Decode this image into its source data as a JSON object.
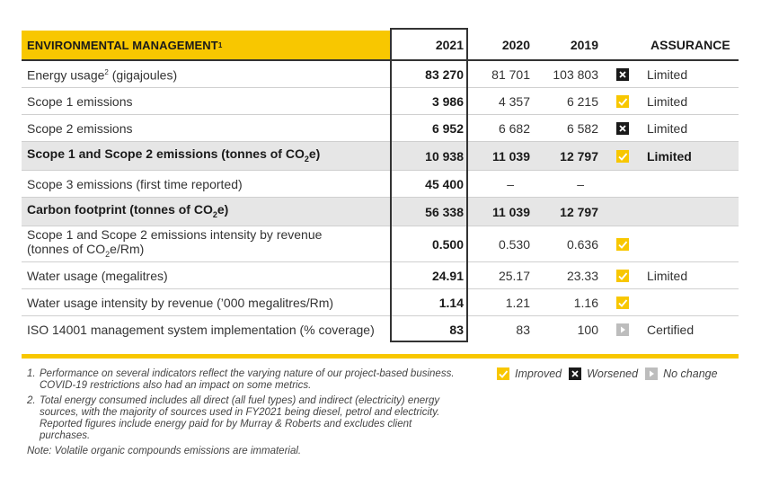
{
  "header": {
    "title": "ENVIRONMENTAL MANAGEMENT",
    "title_sup": "1",
    "years": [
      "2021",
      "2020",
      "2019"
    ],
    "assurance": "ASSURANCE"
  },
  "colors": {
    "accent": "#f8c700",
    "highlight_row": "#e6e6e6",
    "worsened": "#1a1a1a",
    "no_change": "#bdbdbd"
  },
  "rows": [
    {
      "label": "Energy usage",
      "label_sup": "2",
      "label_suffix": " (gigajoules)",
      "v2021": "83 270",
      "v2020": "81 701",
      "v2019": "103 803",
      "status": "worsened",
      "assurance": "Limited"
    },
    {
      "label": "Scope 1 emissions",
      "v2021": "3 986",
      "v2020": "4 357",
      "v2019": "6 215",
      "status": "improved",
      "assurance": "Limited"
    },
    {
      "label": "Scope 2 emissions",
      "v2021": "6 952",
      "v2020": "6 682",
      "v2019": "6 582",
      "status": "worsened",
      "assurance": "Limited"
    },
    {
      "label_pre": "Scope 1 and Scope 2 emissions (tonnes of CO",
      "label_sub": "2",
      "label_post": "e)",
      "v2021": "10 938",
      "v2020": "11 039",
      "v2019": "12 797",
      "status": "improved",
      "assurance": "Limited"
    },
    {
      "label": "Scope 3 emissions (first time reported)",
      "v2021": "45 400",
      "v2020": "–",
      "v2019": "–",
      "status": "",
      "assurance": ""
    },
    {
      "label_pre": "Carbon footprint (tonnes of CO",
      "label_sub": "2",
      "label_post": "e)",
      "v2021": "56 338",
      "v2020": "11 039",
      "v2019": "12 797",
      "status": "",
      "assurance": ""
    },
    {
      "label_line1": "Scope 1 and Scope 2 emissions intensity by revenue",
      "label_pre": "(tonnes of CO",
      "label_sub": "2",
      "label_post": "e/Rm)",
      "v2021": "0.500",
      "v2020": "0.530",
      "v2019": "0.636",
      "status": "improved",
      "assurance": ""
    },
    {
      "label": "Water usage (megalitres)",
      "v2021": "24.91",
      "v2020": "25.17",
      "v2019": "23.33",
      "status": "improved",
      "assurance": "Limited"
    },
    {
      "label": "Water usage intensity by revenue (’000 megalitres/Rm)",
      "v2021": "1.14",
      "v2020": "1.21",
      "v2019": "1.16",
      "status": "improved",
      "assurance": ""
    },
    {
      "label": "ISO 14001 management system implementation (% coverage)",
      "v2021": "83",
      "v2020": "83",
      "v2019": "100",
      "status": "no_change",
      "assurance": "Certified"
    }
  ],
  "notes": [
    {
      "num": "1.",
      "text": "Performance on several indicators reflect the varying nature of our project-based business. COVID-19 restrictions also had an impact on some metrics."
    },
    {
      "num": "2.",
      "text": "Total energy consumed includes all direct (all fuel types) and indirect (electricity) energy sources, with the majority of sources used in FY2021 being diesel, petrol and electricity. Reported figures include energy paid for by Murray & Roberts and excludes client purchases."
    }
  ],
  "note_plain": "Note: Volatile organic compounds emissions are immaterial.",
  "legend": {
    "improved": "Improved",
    "worsened": "Worsened",
    "no_change": "No change"
  }
}
